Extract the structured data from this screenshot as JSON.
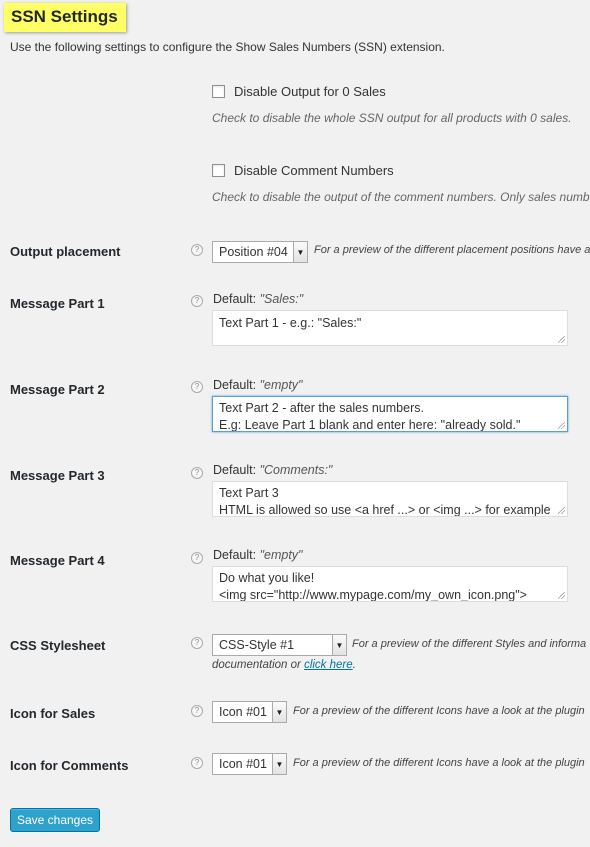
{
  "page": {
    "title": "SSN Settings",
    "intro": "Use the following settings to configure the Show Sales Numbers (SSN) extension."
  },
  "checkboxes": [
    {
      "label": "Disable Output for 0 Sales",
      "checked": false,
      "description": "Check to disable the whole SSN output for all products with 0 sales."
    },
    {
      "label": "Disable Comment Numbers",
      "checked": false,
      "description": "Check to disable the output of the comment numbers. Only sales numb"
    }
  ],
  "help_glyph": "?",
  "output_placement": {
    "label": "Output placement",
    "selected": "Position #04",
    "note": "For a preview of the different placement positions have a"
  },
  "messages": [
    {
      "label": "Message Part 1",
      "default_prefix": "Default:",
      "default_value": "\"Sales:\"",
      "lines": [
        "Text Part 1 - e.g.: \"Sales:\""
      ]
    },
    {
      "label": "Message Part 2",
      "default_prefix": "Default:",
      "default_value": "\"empty\"",
      "lines": [
        "Text Part 2 - after the sales numbers.",
        "E.g: Leave Part 1 blank and enter here: \"already sold.\""
      ]
    },
    {
      "label": "Message Part 3",
      "default_prefix": "Default:",
      "default_value": "\"Comments:\"",
      "lines": [
        "Text Part 3",
        "HTML is allowed so use <a href ...> or <img ...> for example"
      ]
    },
    {
      "label": "Message Part 4",
      "default_prefix": "Default:",
      "default_value": "\"empty\"",
      "lines": [
        "Do what you like!",
        "<img src=\"http://www.mypage.com/my_own_icon.png\">"
      ]
    }
  ],
  "css_stylesheet": {
    "label": "CSS Stylesheet",
    "selected": "CSS-Style #1",
    "note": "For a preview of the different Styles and informa",
    "note2_prefix": "documentation or ",
    "note2_link": "click here",
    "note2_suffix": "."
  },
  "icon_sales": {
    "label": "Icon for Sales",
    "selected": "Icon #01",
    "note": "For a preview of the different Icons have a look at the plugin"
  },
  "icon_comments": {
    "label": "Icon for Comments",
    "selected": "Icon #01",
    "note": "For a preview of the different Icons have a look at the plugin"
  },
  "save_label": "Save changes",
  "colors": {
    "highlight": "#ffff66",
    "button": "#2ea2cc",
    "link": "#0073aa",
    "focus": "#5b9dd9"
  }
}
